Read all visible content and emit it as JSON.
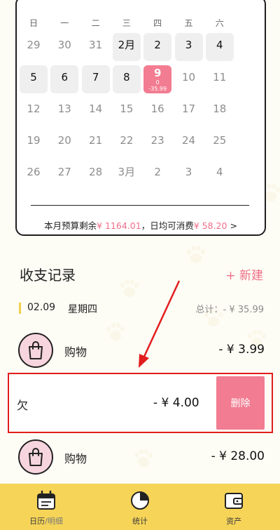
{
  "calendar": {
    "weekdays": [
      "日",
      "一",
      "二",
      "三",
      "四",
      "五",
      "六"
    ],
    "rows": [
      [
        "29",
        "30",
        "31",
        "2月",
        "2",
        "3",
        "4"
      ],
      [
        "5",
        "6",
        "7",
        "8",
        "9",
        "10",
        "11"
      ],
      [
        "12",
        "13",
        "14",
        "15",
        "16",
        "17",
        "18"
      ],
      [
        "19",
        "20",
        "21",
        "22",
        "23",
        "24",
        "25"
      ],
      [
        "26",
        "27",
        "28",
        "3月",
        "2",
        "3",
        "4"
      ]
    ],
    "today": {
      "income": "0",
      "expense": "-35.99"
    },
    "budget_label": "本月预算剩余",
    "budget_value": "¥ 1164.01",
    "daily_label": "，日均可消费",
    "daily_value": "¥ 58.20",
    "arrow": ">"
  },
  "records": {
    "title": "收支记录",
    "new_label": "+ 新建",
    "day": {
      "date": "02.09",
      "weekday": "星期四",
      "total": "总计：- ¥ 35.99"
    },
    "items": [
      {
        "label": "购物",
        "amount": "- ¥ 3.99",
        "icon": "shopping-bag-icon"
      },
      {
        "label": "欠",
        "amount": "- ¥ 4.00",
        "delete_label": "删除"
      },
      {
        "label": "购物",
        "amount": "- ¥ 28.00",
        "icon": "shopping-bag-icon"
      }
    ]
  },
  "tabbar": {
    "calendar_label": "日历",
    "calendar_sep": "/",
    "detail_label": "明细",
    "stats_label": "统计",
    "assets_label": "资产"
  },
  "colors": {
    "accent_pink": "#f27c91",
    "tabbar_yellow": "#f6d458",
    "highlight_red": "#e11d1d"
  }
}
